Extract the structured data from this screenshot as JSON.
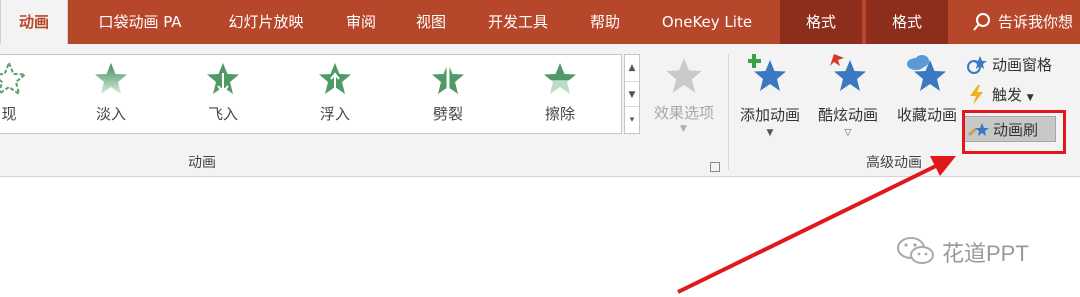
{
  "tabs": {
    "animation": "动画",
    "pocket": "口袋动画 PA",
    "slideshow": "幻灯片放映",
    "review": "审阅",
    "view": "视图",
    "developer": "开发工具",
    "help": "帮助",
    "onekey": "OneKey Lite",
    "format1": "格式",
    "format2": "格式",
    "search": "告诉我你想"
  },
  "gallery": {
    "items": [
      "现",
      "淡入",
      "飞入",
      "浮入",
      "劈裂",
      "擦除"
    ]
  },
  "effect_options": {
    "label": "效果选项"
  },
  "groups": {
    "animation": "动画",
    "advanced": "高级动画"
  },
  "advanced": {
    "add": "添加动画",
    "cool": "酷炫动画",
    "collect": "收藏动画",
    "pane": "动画窗格",
    "trigger": "触发",
    "painter": "动画刷"
  },
  "watermark": {
    "text": "花道PPT"
  },
  "colors": {
    "accent": "#b7472a",
    "callout": "#e0171b",
    "star_green": "#5aa06e",
    "star_blue": "#3a78c2"
  }
}
